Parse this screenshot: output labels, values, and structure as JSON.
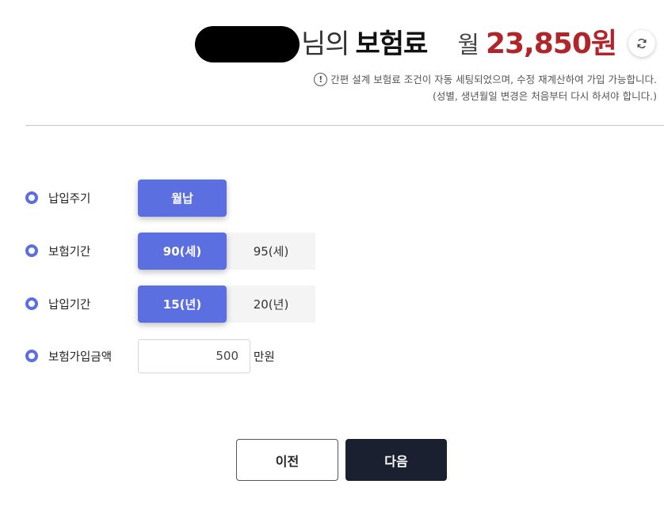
{
  "header": {
    "name_suffix": "님의",
    "title_word": "보험료",
    "monthly_label": "월",
    "premium_amount": "23,850원"
  },
  "icons": {
    "refresh": "refresh-icon",
    "warning": "exclamation-circle-icon"
  },
  "notice": {
    "line1": "간편 설계 보험료 조건이 자동 세팅되었으며, 수정 재계산하여 가입 가능합니다.",
    "line2": "(성별, 생년월일 변경은 처음부터 다시 하셔야 합니다.)"
  },
  "form": {
    "payment_cycle": {
      "label": "납입주기",
      "options": [
        "월납"
      ],
      "selected": "월납"
    },
    "insurance_period": {
      "label": "보험기간",
      "options": [
        "90(세)",
        "95(세)"
      ],
      "selected": "90(세)"
    },
    "payment_period": {
      "label": "납입기간",
      "options": [
        "15(년)",
        "20(년)"
      ],
      "selected": "15(년)"
    },
    "coverage_amount": {
      "label": "보험가입금액",
      "value": "500",
      "unit": "만원"
    }
  },
  "buttons": {
    "prev": "이전",
    "next": "다음"
  },
  "colors": {
    "accent": "#5b6fe0",
    "premium": "#b0252a",
    "primary_button": "#1b2030"
  }
}
